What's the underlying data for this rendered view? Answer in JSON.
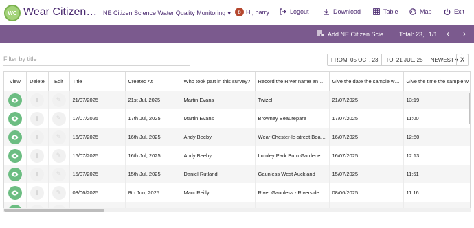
{
  "header": {
    "logo_text": "WC",
    "app_title": "Wear Citizen Science",
    "project": "NE Citizen Science Water Quality Monitoring",
    "user_initial": "b",
    "greeting": "Hi, barry",
    "logout": "Logout",
    "download": "Download",
    "table": "Table",
    "map": "Map",
    "exit": "Exit"
  },
  "toolbar": {
    "add_label": "Add NE Citizen Science Water Quality Monitoring",
    "total": "Total: 23,",
    "pages": "1/1"
  },
  "filters": {
    "placeholder": "Filter by title",
    "from": "FROM: 05 OCT, 23",
    "to": "TO: 21 JUL, 25",
    "sort": "NEWEST",
    "clear": "X"
  },
  "table": {
    "headers": [
      "View",
      "Delete",
      "Edit",
      "Title",
      "Created At",
      "Who took part in this survey?",
      "Record the River name and ...",
      "Give the date the sample wa...",
      "Give the time the sample w..."
    ],
    "rows": [
      [
        "21/07/2025",
        "21st Jul, 2025",
        "Martin Evans",
        "Twizel",
        "21/07/2025",
        "13:19"
      ],
      [
        "17/07/2025",
        "17th Jul, 2025",
        "Martin Evans",
        "Browney Beaurepare",
        "17/07/2025",
        "11:00"
      ],
      [
        "16/07/2025",
        "16th Jul, 2025",
        "Andy Beeby",
        "Wear Chester-le-street Boathouse",
        "16/07/2025",
        "12:50"
      ],
      [
        "16/07/2025",
        "16th Jul, 2025",
        "Andy Beeby",
        "Lumley Park Burn Gardener's Arms",
        "16/07/2025",
        "12:13"
      ],
      [
        "15/07/2025",
        "15th Jul, 2025",
        "Daniel Rutland",
        "Gaunless West Auckland",
        "15/07/2025",
        "11:51"
      ],
      [
        "08/06/2025",
        "8th Jun, 2025",
        "Marc Reilly",
        "River Gaunless - Riverside",
        "08/06/2025",
        "11:16"
      ],
      [
        "",
        "",
        "",
        "",
        "",
        ""
      ]
    ]
  },
  "colors": {
    "brand_purple": "#4b2a70",
    "toolbar_purple": "#7b5a8e",
    "view_green": "#6cbd82",
    "logo_green": "#a4d37a"
  }
}
